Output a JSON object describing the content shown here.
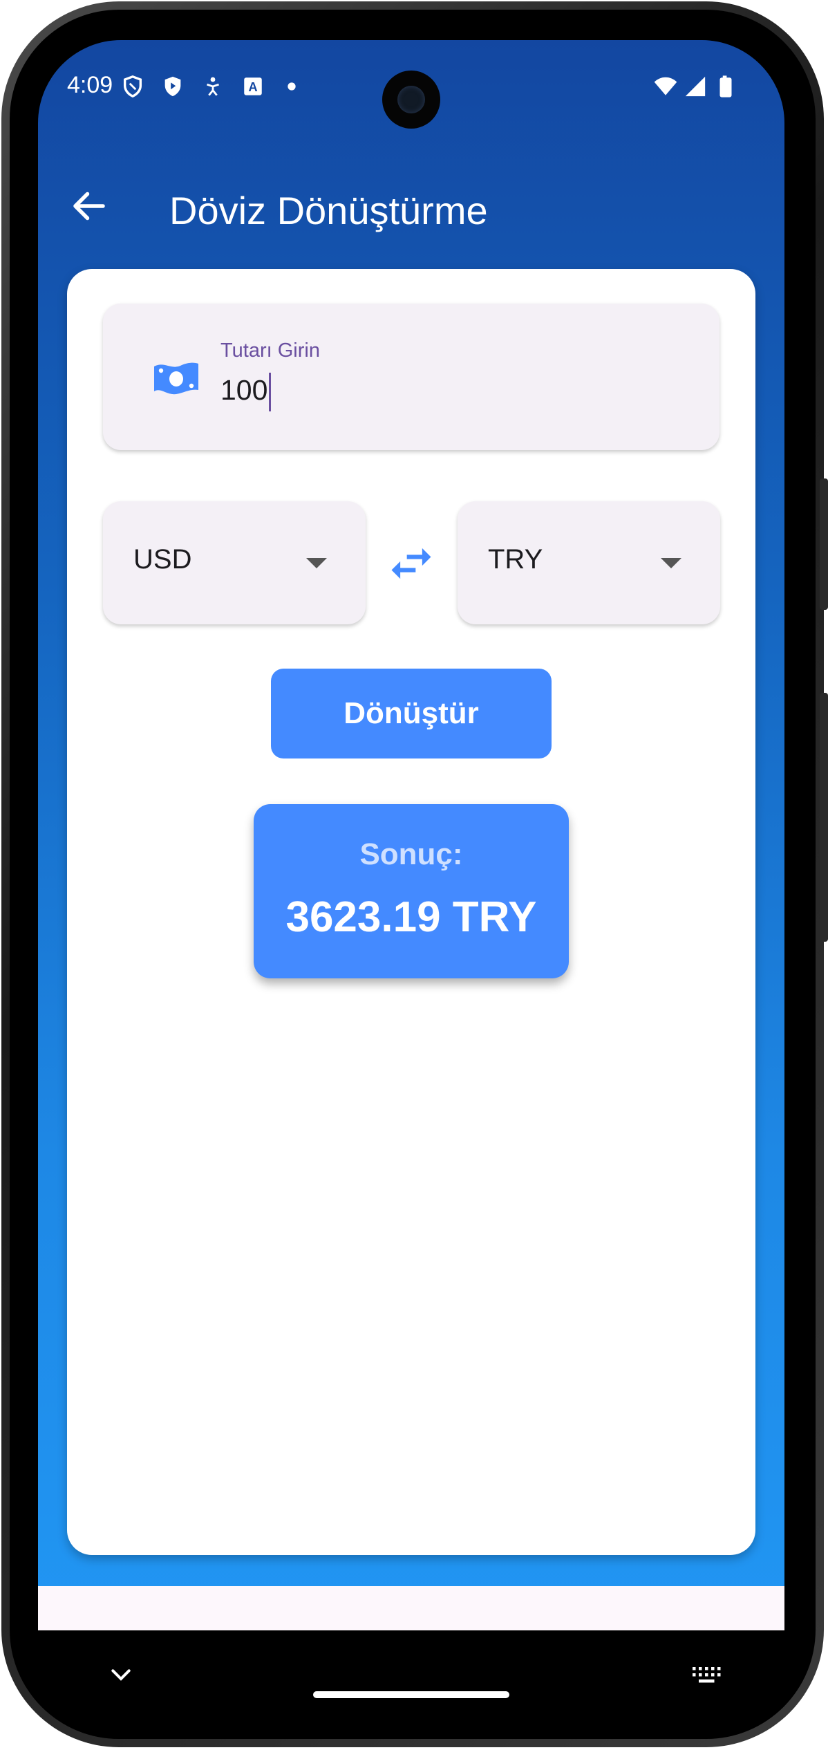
{
  "status_bar": {
    "time": "4:09",
    "left_icons": [
      "shield-icon",
      "play-protect-icon",
      "accessibility-icon",
      "translate-icon",
      "dot-icon"
    ],
    "right_icons": [
      "wifi-icon",
      "signal-icon",
      "battery-icon"
    ]
  },
  "app_bar": {
    "title": "Döviz Dönüştürme",
    "back_icon": "arrow-back-icon"
  },
  "form": {
    "amount_label": "Tutarı Girin",
    "amount_value": "100",
    "amount_icon": "money-icon",
    "from_currency": "USD",
    "to_currency": "TRY",
    "swap_icon": "swap-horiz-icon",
    "convert_label": "Dönüştür"
  },
  "result": {
    "label": "Sonuç:",
    "value": "3623.19 TRY"
  },
  "colors": {
    "primary_blue": "#448aff",
    "app_bar_blue": "#1347a1",
    "field_bg": "#f4f0f6",
    "label_purple": "#6a4fa0"
  },
  "nav_bar": {
    "left_icon": "chevron-down-icon",
    "right_icon": "keyboard-icon"
  }
}
